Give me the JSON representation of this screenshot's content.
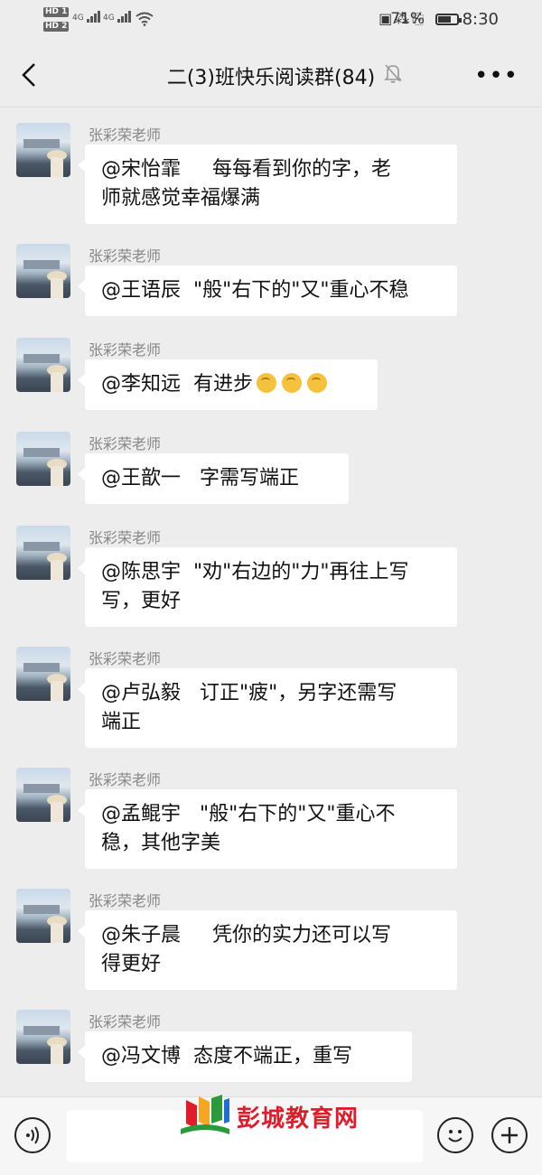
{
  "status_bar": {
    "sim1": "HD 1",
    "sim2": "HD 2",
    "net1": "4G",
    "net2": "4G",
    "battery": "71%",
    "battery_level": 0.71,
    "time": "8:30"
  },
  "nav": {
    "title": "二(3)班快乐阅读群(84)"
  },
  "messages": [
    {
      "sender": "张彩荣老师",
      "text": "@宋怡霏     每每看到你的字，老\n师就感觉幸福爆满"
    },
    {
      "sender": "张彩荣老师",
      "text": "@王语辰  \"般\"右下的\"又\"重心不稳"
    },
    {
      "sender": "张彩荣老师",
      "text": "@李知远  有进步",
      "emoji_count": 3
    },
    {
      "sender": "张彩荣老师",
      "text": "@王歆一   字需写端正"
    },
    {
      "sender": "张彩荣老师",
      "text": "@陈思宇  \"劝\"右边的\"力\"再往上写\n写，更好"
    },
    {
      "sender": "张彩荣老师",
      "text": "@卢弘毅   订正\"疲\"，另字还需写\n端正"
    },
    {
      "sender": "张彩荣老师",
      "text": "@孟鲲宇   \"般\"右下的\"又\"重心不\n稳，其他字美"
    },
    {
      "sender": "张彩荣老师",
      "text": "@朱子晨     凭你的实力还可以写\n得更好"
    },
    {
      "sender": "张彩荣老师",
      "text": "@冯文博  态度不端正，重写"
    }
  ],
  "watermark": {
    "text": "彭城教育网"
  },
  "colors": {
    "background": "#ededed",
    "bubble": "#ffffff",
    "watermark_red": "#e01c2a"
  }
}
